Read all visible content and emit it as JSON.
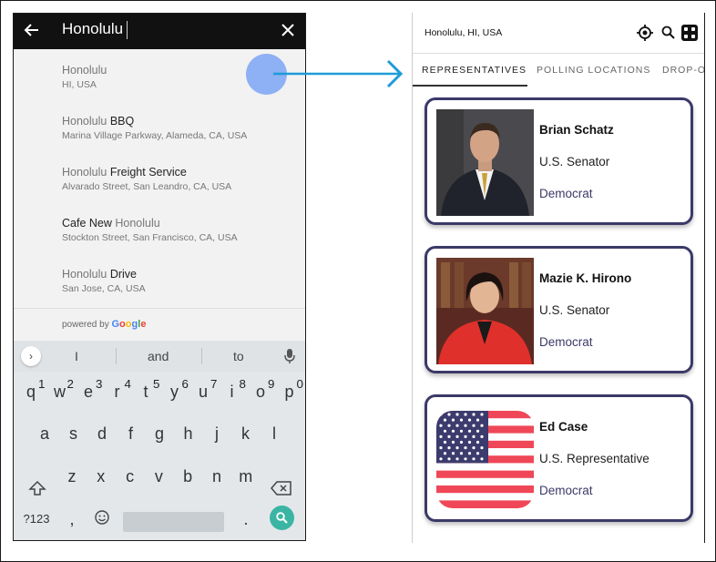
{
  "search": {
    "query": "Honolulu",
    "suggestions": [
      {
        "pre": "",
        "match": "Honolulu",
        "post": "",
        "secondary": "HI, USA"
      },
      {
        "pre": "",
        "match": "Honolulu",
        "post": " BBQ",
        "secondary": "Marina Village Parkway, Alameda, CA, USA"
      },
      {
        "pre": "",
        "match": "Honolulu",
        "post": " Freight Service",
        "secondary": "Alvarado Street, San Leandro, CA, USA"
      },
      {
        "pre": "Cafe New ",
        "match": "Honolulu",
        "post": "",
        "secondary": "Stockton Street, San Francisco, CA, USA"
      },
      {
        "pre": "",
        "match": "Honolulu",
        "post": " Drive",
        "secondary": "San Jose, CA, USA"
      }
    ],
    "powered_by": "powered by",
    "google": [
      "G",
      "o",
      "o",
      "g",
      "l",
      "e"
    ]
  },
  "keyboard": {
    "suggestions": [
      "I",
      "and",
      "to"
    ],
    "row1": [
      {
        "k": "q",
        "n": "1"
      },
      {
        "k": "w",
        "n": "2"
      },
      {
        "k": "e",
        "n": "3"
      },
      {
        "k": "r",
        "n": "4"
      },
      {
        "k": "t",
        "n": "5"
      },
      {
        "k": "y",
        "n": "6"
      },
      {
        "k": "u",
        "n": "7"
      },
      {
        "k": "i",
        "n": "8"
      },
      {
        "k": "o",
        "n": "9"
      },
      {
        "k": "p",
        "n": "0"
      }
    ],
    "row2": [
      "a",
      "s",
      "d",
      "f",
      "g",
      "h",
      "j",
      "k",
      "l"
    ],
    "row3": [
      "z",
      "x",
      "c",
      "v",
      "b",
      "n",
      "m"
    ],
    "symbols_key": "?123",
    "comma_key": ",",
    "period_key": "."
  },
  "app": {
    "location": "Honolulu, HI, USA",
    "tabs": [
      "REPRESENTATIVES",
      "POLLING LOCATIONS",
      "DROP-OFF"
    ],
    "representatives": [
      {
        "name": "Brian Schatz",
        "office": "U.S. Senator",
        "party": "Democrat"
      },
      {
        "name": "Mazie K. Hirono",
        "office": "U.S. Senator",
        "party": "Democrat"
      },
      {
        "name": "Ed Case",
        "office": "U.S. Representative",
        "party": "Democrat"
      }
    ]
  },
  "colors": {
    "accent": "#3b3968",
    "touch_indicator": "#8eb0f4",
    "arrow": "#1d9bd8",
    "enter_key": "#3bb5a3"
  }
}
